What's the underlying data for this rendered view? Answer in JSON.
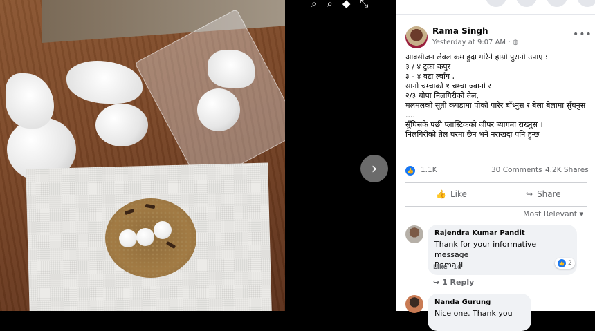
{
  "viewer": {
    "top_icons": [
      "zoom-in-icon",
      "zoom-out-icon",
      "tag-icon",
      "fullscreen-icon"
    ],
    "next_label": "›"
  },
  "post": {
    "author": "Rama Singh",
    "time": "Yesterday at 9:07 AM · ",
    "privacy_icon": "globe-icon",
    "more_label": "•••",
    "text": "आक्सीजन लेवल कम हुदा गरिने हाम्रो पुरानो उपाए :\n३ / ४ टुक्रा कपुर\n३ - ४ वटा ल्वाँग ,\nसानो चम्चाको १ चम्चा ज्वानो र\n२/३ थोपा निलगिरीको तेल,\nमलमलको सूती कपडामा पोको पारेर बाँध्नुस र बेला बेलामा सुँघनुस ....\nसुँघिसके पछी प्लास्टिकको जीपर ब्यागमा राख्नुस ।\nनिलगिरीको तेल घरमा छैन भने नराखदा पनि हुन्छ",
    "likes": "1.1K",
    "comments": "30 Comments",
    "shares": "4.2K Shares",
    "like_action": "Like",
    "share_action": "Share",
    "sort_label": "Most Relevant"
  },
  "comments": [
    {
      "name": "Rajendra Kumar Pandit",
      "text": "Thank for your informative message\nRama ji",
      "like_label": "Like",
      "age": "1d",
      "reactions": "2",
      "reply_label": "1 Reply"
    },
    {
      "name": "Nanda Gurung",
      "text": "Nice one. Thank you"
    }
  ],
  "colors": {
    "facebook_blue": "#1877f2",
    "bubble_bg": "#f0f2f5",
    "meta_gray": "#65676b"
  }
}
